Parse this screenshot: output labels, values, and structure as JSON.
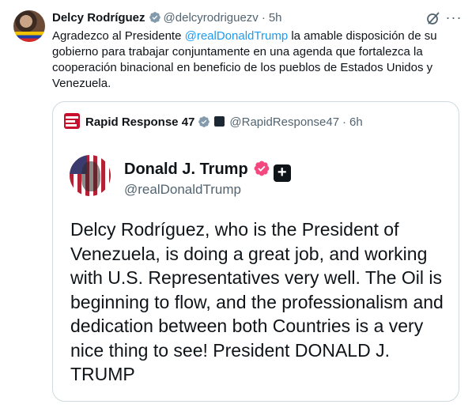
{
  "tweet": {
    "author_name": "Delcy Rodríguez",
    "author_handle": "@delcyrodriguezv",
    "separator": "·",
    "time": "5h",
    "text_before": "Agradezco al Presidente ",
    "mention": "@realDonaldTrump",
    "text_after": " la amable disposición de su gobierno para trabajar conjuntamente en una agenda que fortalezca la cooperación binacional en beneficio de los pueblos de Estados Unidos y Venezuela.",
    "more_label": "···"
  },
  "quote": {
    "author_name": "Rapid Response 47",
    "author_handle": "@RapidResponse47",
    "separator": "·",
    "time": "6h"
  },
  "card": {
    "name": "Donald J. Trump",
    "handle": "@realDonaldTrump",
    "plus_label": "+",
    "text": "Delcy Rodríguez, who is the President of Venezuela, is doing a great job, and working with U.S. Representatives very well. The Oil is beginning to flow, and the professionalism and dedication between both Countries is a very nice thing to see! President DONALD J. TRUMP"
  },
  "colors": {
    "link": "#1d9bf0",
    "verified_blue": "#1d9bf0",
    "verified_gray": "#829aab",
    "verified_pink": "#e0245e",
    "muted": "#536471",
    "border": "#cfd9de"
  },
  "icons": {
    "verified": "verified-badge-icon",
    "grok": "grok-icon",
    "more": "more-icon",
    "affiliate": "affiliate-badge-icon"
  }
}
